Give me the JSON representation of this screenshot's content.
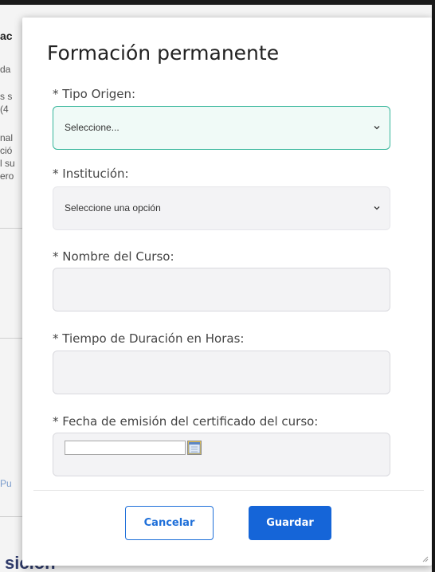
{
  "background": {
    "fragments": [
      "ac",
      "da",
      "s s",
      "(4",
      "nal",
      "ció",
      "l su",
      "ero",
      "Pu"
    ],
    "bottom_text": "sicion"
  },
  "modal": {
    "title": "Formación permanente",
    "fields": {
      "tipo_origen": {
        "label": "* Tipo Origen:",
        "value": "Seleccione..."
      },
      "institucion": {
        "label": "* Institución:",
        "value": "Seleccione una opción"
      },
      "nombre_curso": {
        "label": "* Nombre del Curso:",
        "value": ""
      },
      "tiempo_duracion": {
        "label": "* Tiempo de Duración en Horas:",
        "value": ""
      },
      "fecha_emision": {
        "label": "* Fecha de emisión del certificado del curso:",
        "value": ""
      }
    },
    "buttons": {
      "cancel": "Cancelar",
      "save": "Guardar"
    }
  },
  "colors": {
    "primary": "#1565d8",
    "focus_border": "#34b59a"
  },
  "icons": [
    "chevron-down-icon",
    "calendar-icon",
    "resize-grip-icon"
  ]
}
